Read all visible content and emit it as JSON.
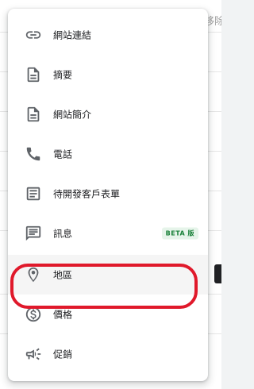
{
  "background": {
    "corner_text": "移除"
  },
  "menu": {
    "items": [
      {
        "label": "網站連結",
        "icon": "link-icon"
      },
      {
        "label": "摘要",
        "icon": "document-icon"
      },
      {
        "label": "網站簡介",
        "icon": "description-icon"
      },
      {
        "label": "電話",
        "icon": "phone-icon"
      },
      {
        "label": "待開發客戶表單",
        "icon": "form-icon"
      },
      {
        "label": "訊息",
        "icon": "message-icon",
        "badge": "BETA 版"
      },
      {
        "label": "地區",
        "icon": "location-pin-icon",
        "selected": true
      },
      {
        "label": "價格",
        "icon": "price-tag-icon"
      },
      {
        "label": "促銷",
        "icon": "promotion-megaphone-icon"
      }
    ]
  },
  "colors": {
    "highlight": "#e0192b",
    "icon": "#5f6368",
    "beta_bg": "#e6f4ea",
    "beta_text": "#188038"
  }
}
